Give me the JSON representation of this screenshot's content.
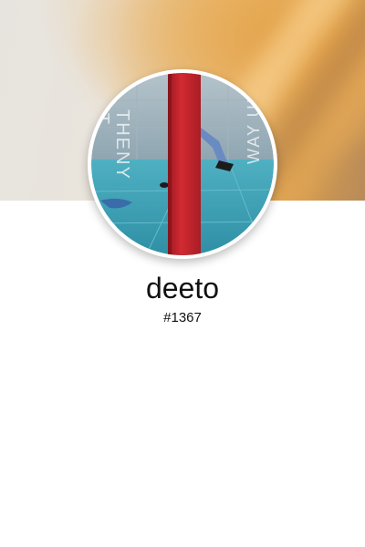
{
  "profile": {
    "username": "deeto",
    "user_id": "#1367",
    "avatar": {
      "kind": "album-cover-art",
      "cover_text_left": [
        "AT",
        "THENY"
      ],
      "cover_text_right": "WAY UP"
    }
  },
  "colors": {
    "header_gradient_light": "#e8e4de",
    "header_gradient_warm": "#e3a64f",
    "cover_sky": "#9fb4c0",
    "cover_ground": "#3e9fb4",
    "cover_pole": "#c8242c",
    "text_primary": "#111111"
  }
}
